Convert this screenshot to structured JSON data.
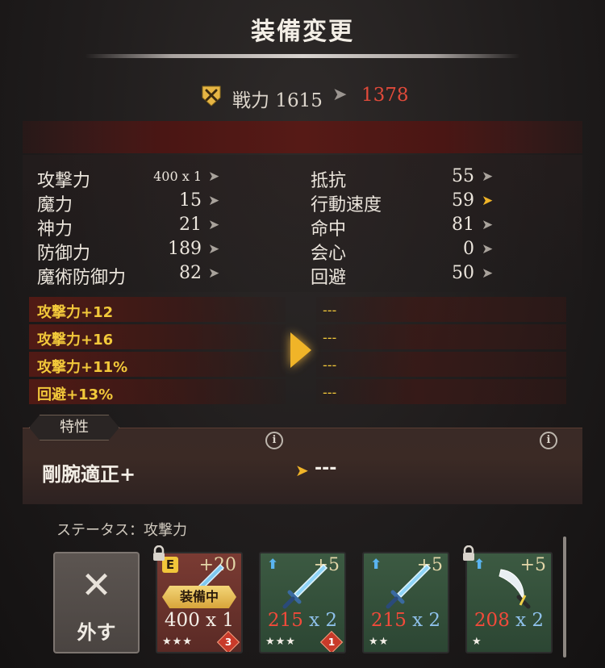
{
  "header": {
    "title": "装備変更"
  },
  "power": {
    "label": "戦力",
    "current": "1615",
    "arrow": "➤",
    "new": "1378"
  },
  "stats_left": [
    {
      "label": "攻撃力",
      "value": "400 x 1"
    },
    {
      "label": "魔力",
      "value": "15"
    },
    {
      "label": "神力",
      "value": "21"
    },
    {
      "label": "防御力",
      "value": "189"
    },
    {
      "label": "魔術防御力",
      "value": "82"
    }
  ],
  "stats_right": [
    {
      "label": "抵抗",
      "value": "55",
      "highlight": false
    },
    {
      "label": "行動速度",
      "value": "59",
      "highlight": true
    },
    {
      "label": "命中",
      "value": "81",
      "highlight": false
    },
    {
      "label": "会心",
      "value": "0",
      "highlight": false
    },
    {
      "label": "回避",
      "value": "50",
      "highlight": false
    }
  ],
  "bonuses_current": [
    "攻撃力+12",
    "攻撃力+16",
    "攻撃力+11%",
    "回避+13%"
  ],
  "bonuses_new": [
    "---",
    "---",
    "---",
    "---"
  ],
  "traits": {
    "tab_label": "特性",
    "current": "剛腕適正+",
    "new": "---",
    "info_glyph": "i"
  },
  "status_filter": {
    "label": "ステータス：攻撃力"
  },
  "unequip": {
    "label": "外す",
    "glyph": "✕"
  },
  "cards": [
    {
      "plus": "+20",
      "equipped_label": "装備中",
      "atk": "400",
      "mult": "x 1",
      "stars": "★★★",
      "rank": "3",
      "badge": "E",
      "locked": true,
      "bg": "red"
    },
    {
      "plus": "+5",
      "atk": "215",
      "mult": "x 2",
      "stars": "★★★",
      "rank": "1",
      "locked": false,
      "bg": "green"
    },
    {
      "plus": "+5",
      "atk": "215",
      "mult": "x 2",
      "stars": "★★",
      "rank": "",
      "locked": false,
      "bg": "green"
    },
    {
      "plus": "+5",
      "atk": "208",
      "mult": "x 2",
      "stars": "★",
      "rank": "",
      "locked": true,
      "bg": "green"
    }
  ],
  "colors": {
    "accent_gold": "#f0b428",
    "power_drop_red": "#e04a3a",
    "bonus_yellow": "#f2c83a"
  },
  "icons": {
    "power": "crossed-swords-shield-icon",
    "chevron": "chevron-right-icon",
    "sword": "sword-icon",
    "scimitar": "scimitar-icon",
    "lock": "lock-icon",
    "upgrade": "up-arrow-icon"
  }
}
